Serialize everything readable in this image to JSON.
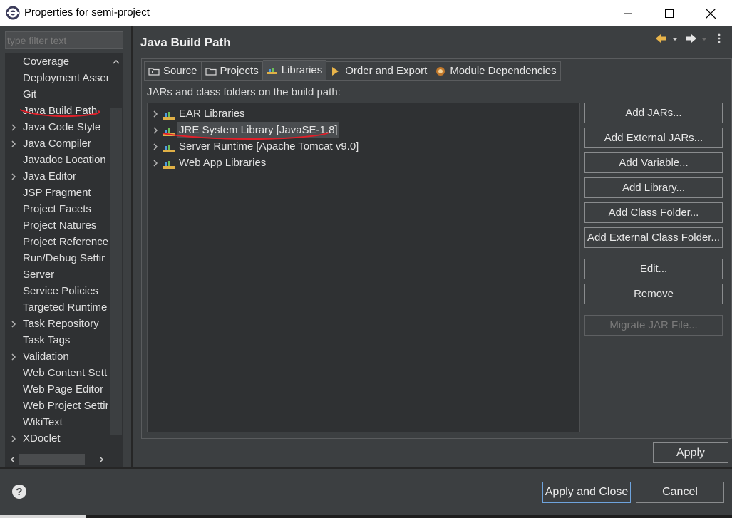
{
  "window": {
    "title": "Properties for semi-project"
  },
  "sidebar": {
    "filter_placeholder": "type filter text",
    "items": [
      {
        "label": "Coverage",
        "expandable": false
      },
      {
        "label": "Deployment Asser",
        "expandable": false
      },
      {
        "label": "Git",
        "expandable": false
      },
      {
        "label": "Java Build Path",
        "expandable": false,
        "selected": true
      },
      {
        "label": "Java Code Style",
        "expandable": true
      },
      {
        "label": "Java Compiler",
        "expandable": true
      },
      {
        "label": "Javadoc Location",
        "expandable": false
      },
      {
        "label": "Java Editor",
        "expandable": true
      },
      {
        "label": "JSP Fragment",
        "expandable": false
      },
      {
        "label": "Project Facets",
        "expandable": false
      },
      {
        "label": "Project Natures",
        "expandable": false
      },
      {
        "label": "Project Reference",
        "expandable": false
      },
      {
        "label": "Run/Debug Settir",
        "expandable": false
      },
      {
        "label": "Server",
        "expandable": false
      },
      {
        "label": "Service Policies",
        "expandable": false
      },
      {
        "label": "Targeted Runtime",
        "expandable": false
      },
      {
        "label": "Task Repository",
        "expandable": true
      },
      {
        "label": "Task Tags",
        "expandable": false
      },
      {
        "label": "Validation",
        "expandable": true
      },
      {
        "label": "Web Content Sett",
        "expandable": false
      },
      {
        "label": "Web Page Editor",
        "expandable": false
      },
      {
        "label": "Web Project Settir",
        "expandable": false
      },
      {
        "label": "WikiText",
        "expandable": false
      },
      {
        "label": "XDoclet",
        "expandable": true
      }
    ]
  },
  "page": {
    "title": "Java Build Path"
  },
  "tabs": [
    {
      "label": "Source",
      "icon": "source-folder-icon",
      "active": false
    },
    {
      "label": "Projects",
      "icon": "projects-folder-icon",
      "active": false
    },
    {
      "label": "Libraries",
      "icon": "libraries-icon",
      "active": true
    },
    {
      "label": "Order and Export",
      "icon": "order-export-icon",
      "active": false
    },
    {
      "label": "Module Dependencies",
      "icon": "module-icon",
      "active": false
    }
  ],
  "libraries": {
    "hint": "JARs and class folders on the build path:",
    "items": [
      {
        "label": "EAR Libraries",
        "selected": false
      },
      {
        "label": "JRE System Library [JavaSE-1.8]",
        "selected": true
      },
      {
        "label": "Server Runtime [Apache Tomcat v9.0]",
        "selected": false
      },
      {
        "label": "Web App Libraries",
        "selected": false
      }
    ]
  },
  "buttons": {
    "add_jars": "Add JARs...",
    "add_external_jars": "Add External JARs...",
    "add_variable": "Add Variable...",
    "add_library": "Add Library...",
    "add_class_folder": "Add Class Folder...",
    "add_external_class_folder": "Add External Class Folder...",
    "edit": "Edit...",
    "remove": "Remove",
    "migrate_jar": "Migrate JAR File...",
    "apply": "Apply",
    "apply_and_close": "Apply and Close",
    "cancel": "Cancel"
  },
  "colors": {
    "background": "#3c3f41",
    "tree_background": "#2f3133",
    "annotation_red": "#e0202a",
    "nav_arrow": "#e8b44a"
  }
}
